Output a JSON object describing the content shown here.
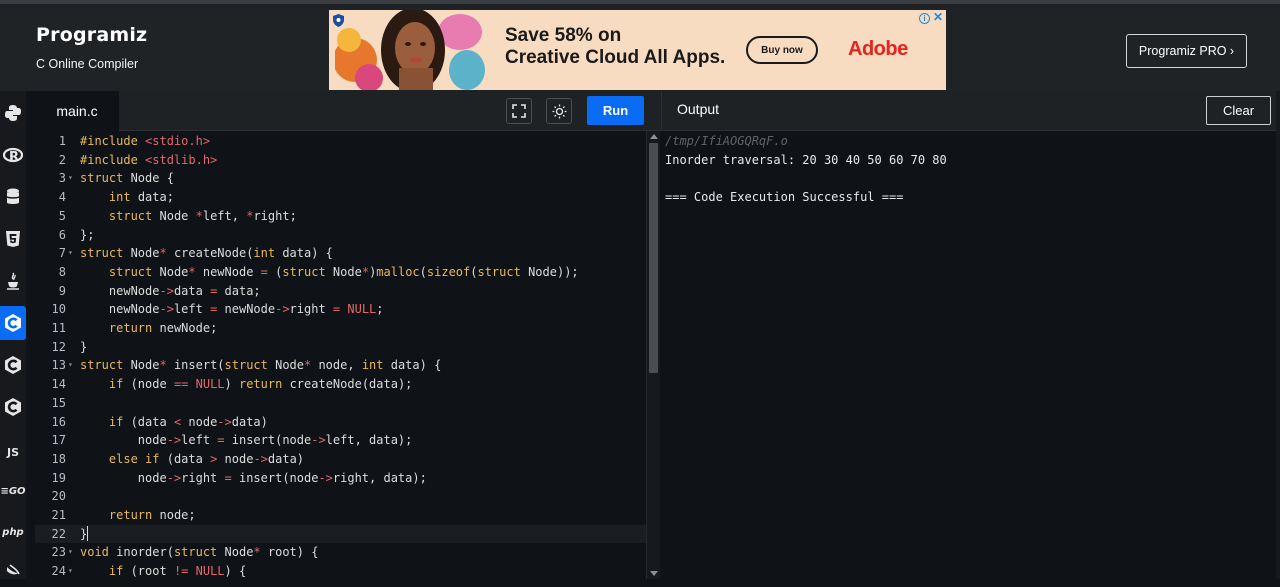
{
  "header": {
    "logo": "Programiz",
    "subtitle": "C Online Compiler",
    "pro_button": "Programiz PRO ›"
  },
  "ad": {
    "headline_line1": "Save 58% on",
    "headline_line2": "Creative Cloud All Apps.",
    "cta": "Buy now",
    "brand": "Adobe",
    "info_icon": "info-icon",
    "close_icon": "close-icon"
  },
  "languages": [
    {
      "name": "python",
      "icon": "python-icon",
      "label": ""
    },
    {
      "name": "r",
      "icon": "r-icon",
      "label": "R"
    },
    {
      "name": "sql",
      "icon": "database-icon",
      "label": ""
    },
    {
      "name": "html",
      "icon": "html5-icon",
      "label": "5"
    },
    {
      "name": "java",
      "icon": "java-icon",
      "label": ""
    },
    {
      "name": "c",
      "icon": "c-icon",
      "label": "C",
      "active": true
    },
    {
      "name": "cpp",
      "icon": "cpp-icon",
      "label": "C"
    },
    {
      "name": "csharp",
      "icon": "csharp-icon",
      "label": "C"
    },
    {
      "name": "javascript",
      "icon": "js-icon",
      "label": "JS"
    },
    {
      "name": "go",
      "icon": "go-icon",
      "label": "GO"
    },
    {
      "name": "php",
      "icon": "php-icon",
      "label": "php"
    },
    {
      "name": "swift",
      "icon": "swift-icon",
      "label": ""
    }
  ],
  "editor": {
    "file_tab": "main.c",
    "run_label": "Run",
    "fullscreen_icon": "fullscreen-icon",
    "theme_icon": "sun-icon",
    "active_line": 22,
    "lines": [
      {
        "n": "1",
        "fold": "",
        "code": "#include <stdio.h>"
      },
      {
        "n": "2",
        "fold": "",
        "code": "#include <stdlib.h>"
      },
      {
        "n": "3",
        "fold": "▾",
        "code": "struct Node {"
      },
      {
        "n": "4",
        "fold": "",
        "code": "    int data;"
      },
      {
        "n": "5",
        "fold": "",
        "code": "    struct Node *left, *right;"
      },
      {
        "n": "6",
        "fold": "",
        "code": "};"
      },
      {
        "n": "7",
        "fold": "▾",
        "code": "struct Node* createNode(int data) {"
      },
      {
        "n": "8",
        "fold": "",
        "code": "    struct Node* newNode = (struct Node*)malloc(sizeof(struct Node));"
      },
      {
        "n": "9",
        "fold": "",
        "code": "    newNode->data = data;"
      },
      {
        "n": "10",
        "fold": "",
        "code": "    newNode->left = newNode->right = NULL;"
      },
      {
        "n": "11",
        "fold": "",
        "code": "    return newNode;"
      },
      {
        "n": "12",
        "fold": "",
        "code": "}"
      },
      {
        "n": "13",
        "fold": "▾",
        "code": "struct Node* insert(struct Node* node, int data) {"
      },
      {
        "n": "14",
        "fold": "",
        "code": "    if (node == NULL) return createNode(data);"
      },
      {
        "n": "15",
        "fold": "",
        "code": ""
      },
      {
        "n": "16",
        "fold": "",
        "code": "    if (data < node->data)"
      },
      {
        "n": "17",
        "fold": "",
        "code": "        node->left = insert(node->left, data);"
      },
      {
        "n": "18",
        "fold": "",
        "code": "    else if (data > node->data)"
      },
      {
        "n": "19",
        "fold": "",
        "code": "        node->right = insert(node->right, data);"
      },
      {
        "n": "20",
        "fold": "",
        "code": ""
      },
      {
        "n": "21",
        "fold": "",
        "code": "    return node;"
      },
      {
        "n": "22",
        "fold": "",
        "code": "}"
      },
      {
        "n": "23",
        "fold": "▾",
        "code": "void inorder(struct Node* root) {"
      },
      {
        "n": "24",
        "fold": "▾",
        "code": "    if (root != NULL) {"
      }
    ]
  },
  "output": {
    "title": "Output",
    "clear_label": "Clear",
    "lines": [
      "/tmp/IfiAOGQRqF.o",
      "Inorder traversal: 20 30 40 50 60 70 80",
      "",
      "=== Code Execution Successful ==="
    ]
  },
  "colors": {
    "accent": "#0a6cf5",
    "keyword": "#e8b85a",
    "string_operator": "#e06868",
    "background": "#0f1318",
    "panel": "#1f2225"
  }
}
